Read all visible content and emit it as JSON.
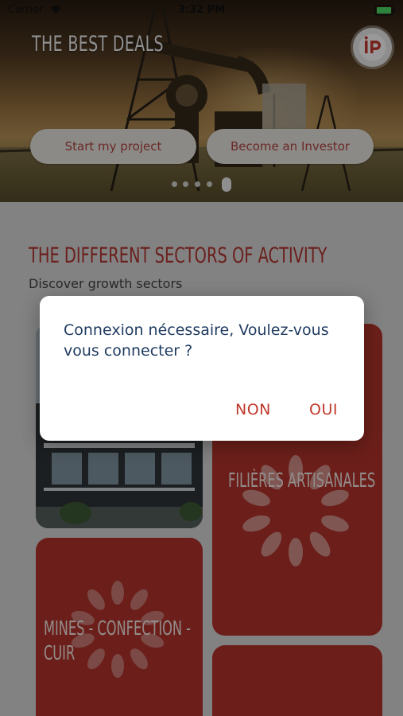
{
  "status_bar": {
    "carrier": "Carrier",
    "time": "3:32 PM",
    "wifi_icon": "wifi-icon",
    "battery_icon": "battery-icon"
  },
  "hero": {
    "title": "THE BEST DEALS",
    "logo_icon": "brand-logo-icon",
    "start_project_label": "Start my project",
    "become_investor_label": "Become an Investor",
    "pager": {
      "pages": 5,
      "active_index": 4
    }
  },
  "sectors": {
    "title": "THE DIFFERENT SECTORS OF ACTIVITY",
    "subtitle": "Discover growth sectors",
    "cards": [
      {
        "label": "",
        "kind": "image"
      },
      {
        "label": "FILIÈRES ARTISANALES",
        "kind": "loading"
      },
      {
        "label_line1": "MINES - CONFECTION -",
        "label_line2": "CUIR",
        "kind": "loading"
      },
      {
        "label": "",
        "kind": "loading"
      }
    ]
  },
  "dialog": {
    "message": "Connexion nécessaire, Voulez-vous vous connecter ?",
    "cancel_label": "NON",
    "confirm_label": "OUI"
  },
  "colors": {
    "brand_red": "#b4342c",
    "dialog_text": "#1e3a5f",
    "dialog_action": "#c0392b",
    "cta_text": "#b2443f"
  }
}
